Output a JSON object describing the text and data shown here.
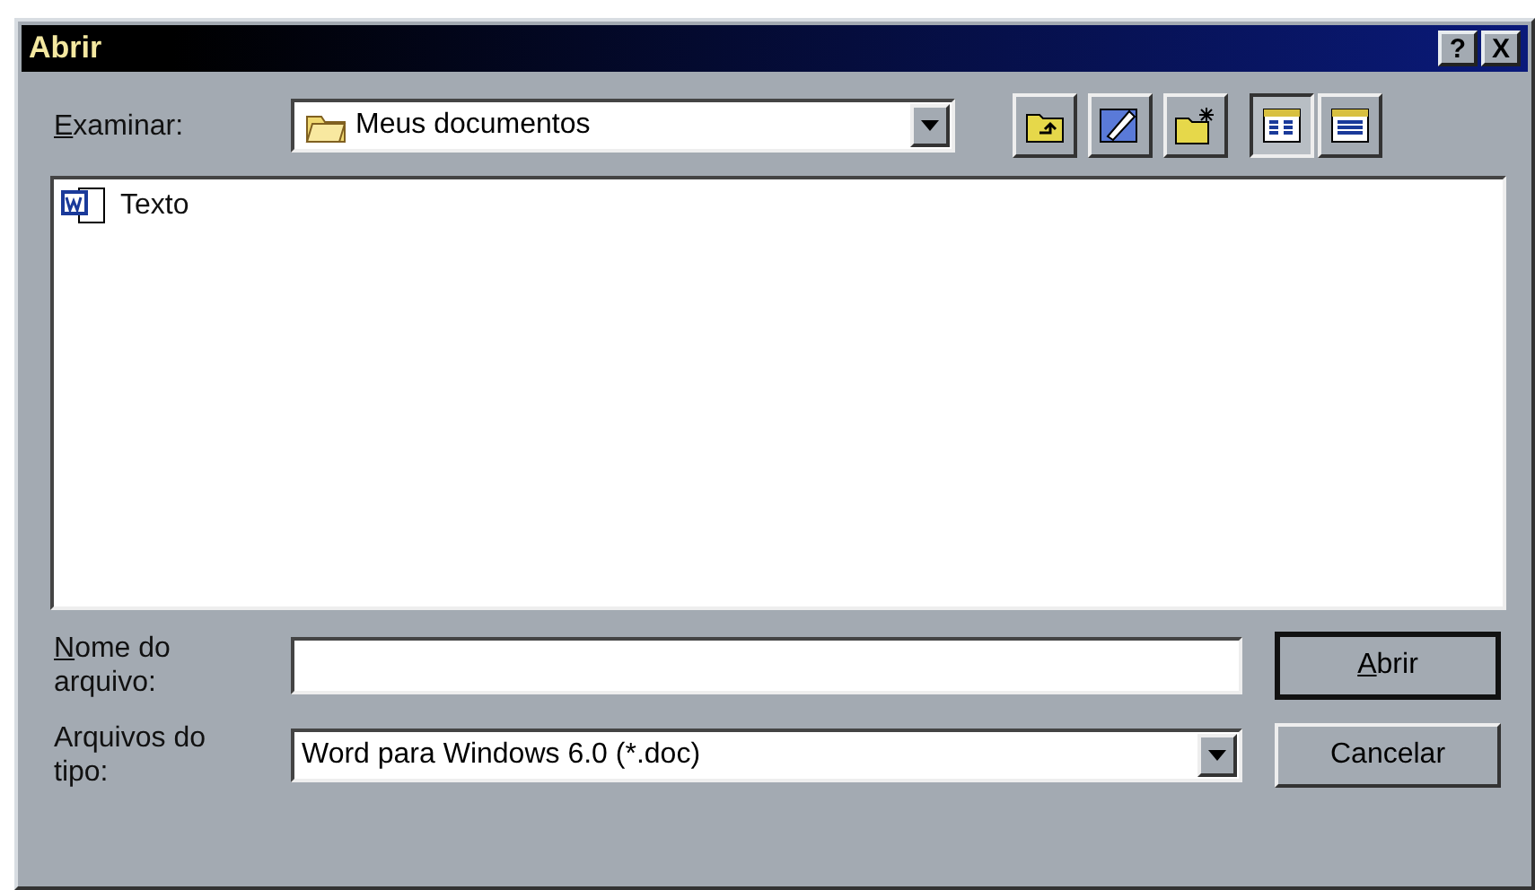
{
  "window": {
    "title": "Abrir",
    "title_buttons": [
      {
        "kind": "help",
        "label": "?"
      },
      {
        "kind": "close",
        "label": "X"
      }
    ]
  },
  "look_in": {
    "label": "Examinar:",
    "underline_first": true,
    "value": "Meus documentos"
  },
  "toolbar": [
    {
      "kind": "up_folder",
      "selected": false
    },
    {
      "kind": "favorites",
      "selected": false
    },
    {
      "kind": "new_folder",
      "selected": false
    },
    {
      "kind": "list_view",
      "selected": true
    },
    {
      "kind": "details_view",
      "selected": false
    }
  ],
  "files": [
    {
      "name": "Texto",
      "selected": false
    }
  ],
  "file_name": {
    "label_lines": [
      "Nome do",
      "arquivo:"
    ],
    "underline_first": true
  },
  "file_type": {
    "label_lines": [
      "Arquivos do",
      "tipo:"
    ],
    "underline_first": false,
    "value": "Word para Windows 6.0 (*.doc)"
  },
  "buttons": [
    {
      "label": "Abrir",
      "underline_first": true,
      "default": true
    },
    {
      "label": "Cancelar",
      "underline_first": false,
      "default": false
    }
  ]
}
